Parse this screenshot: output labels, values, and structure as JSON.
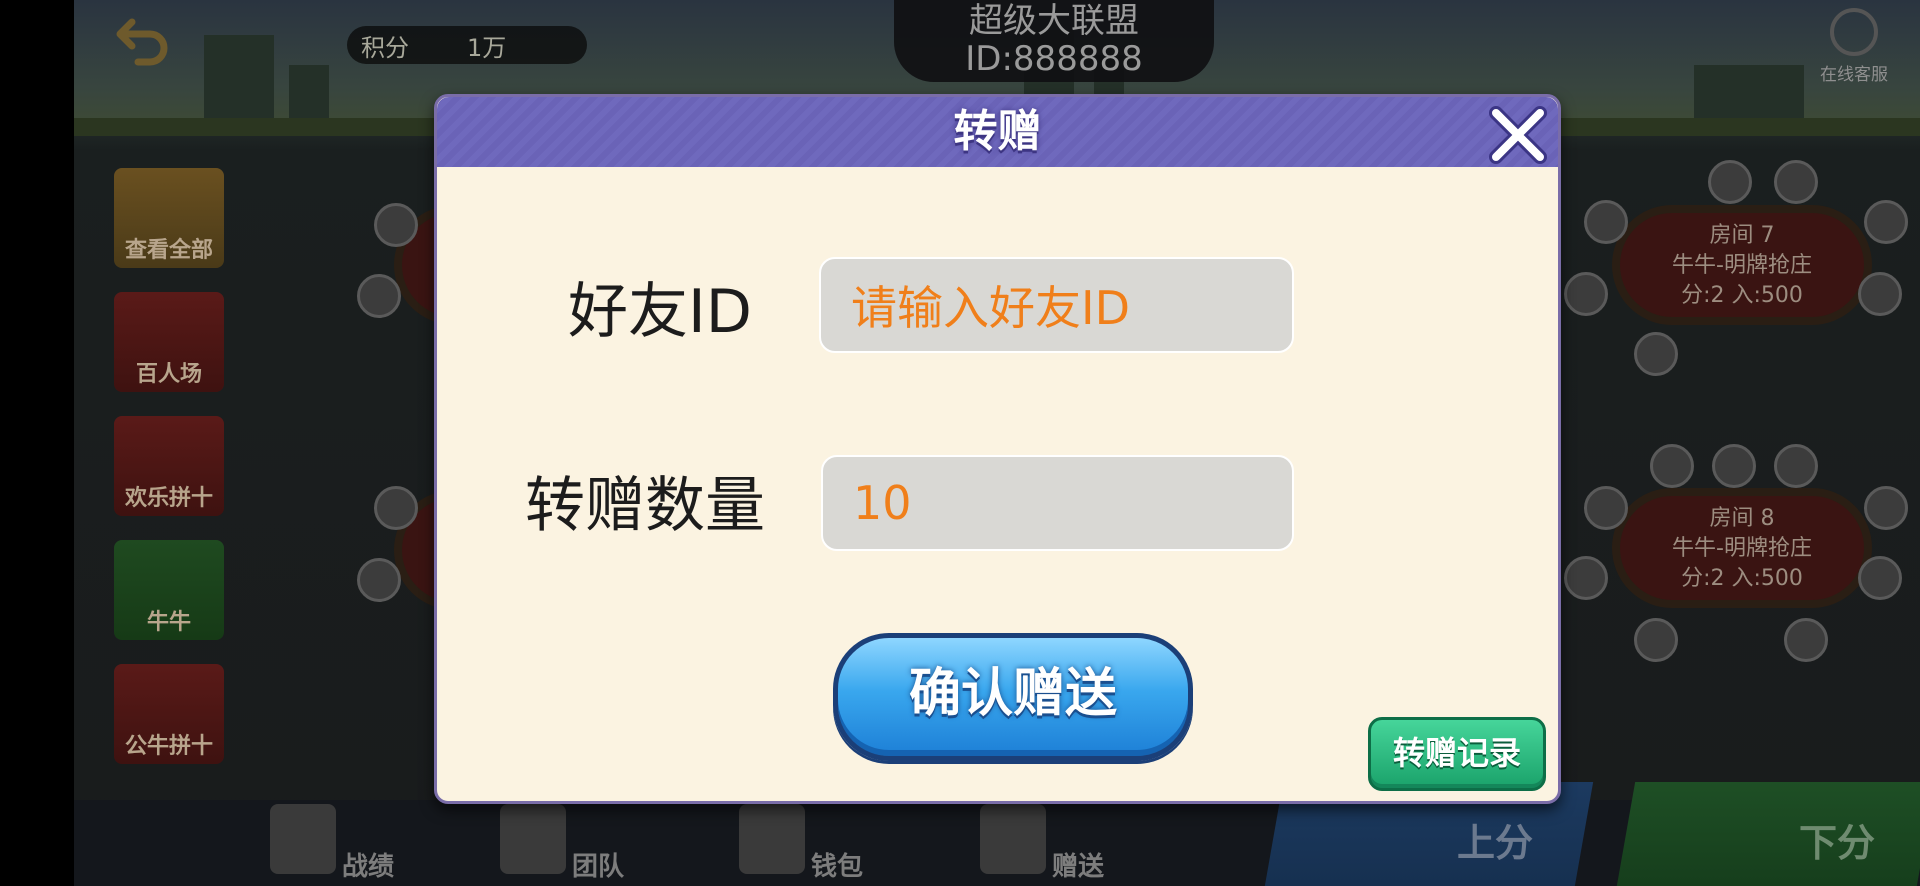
{
  "lobby": {
    "score_label": "积分",
    "score_value": "1万",
    "club_name": "超级大联盟",
    "club_id": "ID:888888",
    "service_label": "在线客服",
    "menu": [
      {
        "label": "查看全部"
      },
      {
        "label": "百人场"
      },
      {
        "label": "欢乐拼十"
      },
      {
        "label": "牛牛"
      },
      {
        "label": "公牛拼十"
      }
    ],
    "rooms": [
      {
        "name": "房间 7",
        "mode": "牛牛-明牌抢庄",
        "stats": "分:2    入:500"
      },
      {
        "name": "房间 8",
        "mode": "牛牛-明牌抢庄",
        "stats": "分:2    入:500"
      }
    ],
    "bottom_nav": [
      {
        "label": "战绩",
        "icon": "trophy-icon"
      },
      {
        "label": "团队",
        "icon": "team-icon"
      },
      {
        "label": "钱包",
        "icon": "wallet-icon"
      },
      {
        "label": "赠送",
        "icon": "gift-icon"
      }
    ],
    "up_label": "上分",
    "down_label": "下分"
  },
  "modal": {
    "title": "转赠",
    "friend_id_label": "好友ID",
    "friend_id_placeholder": "请输入好友ID",
    "amount_label": "转赠数量",
    "amount_value": "10",
    "confirm_label": "确认赠送",
    "record_label": "转赠记录"
  },
  "colors": {
    "header": "#6a63b7",
    "modal_bg": "#fbf3e1",
    "input_text": "#f07f1a",
    "confirm": "#39a7ee",
    "record": "#1aa26a"
  }
}
